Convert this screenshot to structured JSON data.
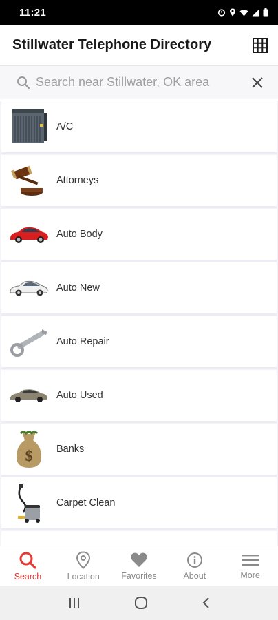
{
  "status_bar": {
    "time": "11:21",
    "icons": [
      "alarm-icon",
      "location-icon",
      "wifi-icon",
      "signal-icon",
      "battery-icon"
    ]
  },
  "header": {
    "title": "Stillwater Telephone Directory",
    "grid_icon": "grid-icon"
  },
  "search": {
    "placeholder": "Search near Stillwater, OK area",
    "value": ""
  },
  "categories": [
    {
      "label": "A/C",
      "icon": "ac-unit-image"
    },
    {
      "label": "Attorneys",
      "icon": "gavel-image"
    },
    {
      "label": "Auto Body",
      "icon": "red-car-image"
    },
    {
      "label": "Auto New",
      "icon": "white-car-image"
    },
    {
      "label": "Auto Repair",
      "icon": "wrench-image"
    },
    {
      "label": "Auto Used",
      "icon": "sedan-image"
    },
    {
      "label": "Banks",
      "icon": "money-bag-image"
    },
    {
      "label": "Carpet Clean",
      "icon": "vacuum-image"
    }
  ],
  "bottom_nav": [
    {
      "label": "Search",
      "icon": "search-icon",
      "active": true
    },
    {
      "label": "Location",
      "icon": "location-pin-icon",
      "active": false
    },
    {
      "label": "Favorites",
      "icon": "heart-icon",
      "active": false
    },
    {
      "label": "About",
      "icon": "info-icon",
      "active": false
    },
    {
      "label": "More",
      "icon": "menu-icon",
      "active": false
    }
  ],
  "colors": {
    "accent": "#e53935",
    "inactive": "#8a8a8a",
    "list_bg": "#f3f3f8"
  }
}
